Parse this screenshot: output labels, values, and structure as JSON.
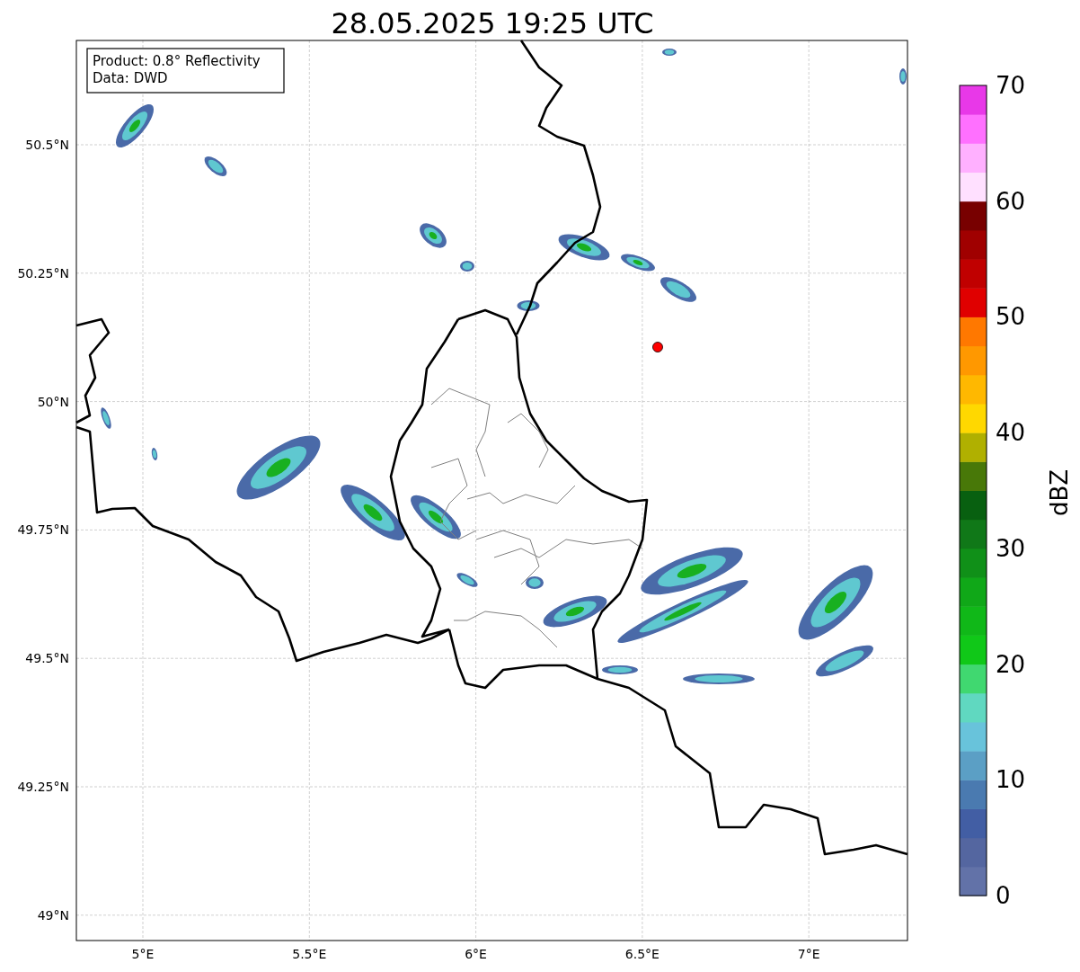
{
  "title": "28.05.2025 19:25 UTC",
  "legend": [
    "Product: 0.8° Reflectivity",
    "Data: DWD"
  ],
  "map": {
    "xticks": [
      "5°E",
      "5.5°E",
      "6°E",
      "6.5°E",
      "7°E"
    ],
    "yticks": [
      "50.5°N",
      "50.25°N",
      "50°N",
      "49.75°N",
      "49.5°N",
      "49.25°N",
      "49°N"
    ]
  },
  "colorbar": {
    "label": "dBZ",
    "ticks": [
      "70",
      "60",
      "50",
      "40",
      "30",
      "20",
      "10",
      "0"
    ],
    "segments": [
      {
        "color": "#6272a8"
      },
      {
        "color": "#5466a0"
      },
      {
        "color": "#425ea4"
      },
      {
        "color": "#4a7ab0"
      },
      {
        "color": "#5b9fc5"
      },
      {
        "color": "#68c3db"
      },
      {
        "color": "#60d8c0"
      },
      {
        "color": "#40d870"
      },
      {
        "color": "#10c818"
      },
      {
        "color": "#10b818"
      },
      {
        "color": "#10a818"
      },
      {
        "color": "#109018"
      },
      {
        "color": "#107818"
      },
      {
        "color": "#086010"
      },
      {
        "color": "#487808"
      },
      {
        "color": "#b0b000"
      },
      {
        "color": "#ffd800"
      },
      {
        "color": "#ffb800"
      },
      {
        "color": "#ff9800"
      },
      {
        "color": "#ff7800"
      },
      {
        "color": "#e00000"
      },
      {
        "color": "#c00000"
      },
      {
        "color": "#a00000"
      },
      {
        "color": "#780000"
      },
      {
        "color": "#ffe0ff"
      },
      {
        "color": "#ffb0ff"
      },
      {
        "color": "#ff70ff"
      },
      {
        "color": "#e838e8"
      }
    ]
  }
}
